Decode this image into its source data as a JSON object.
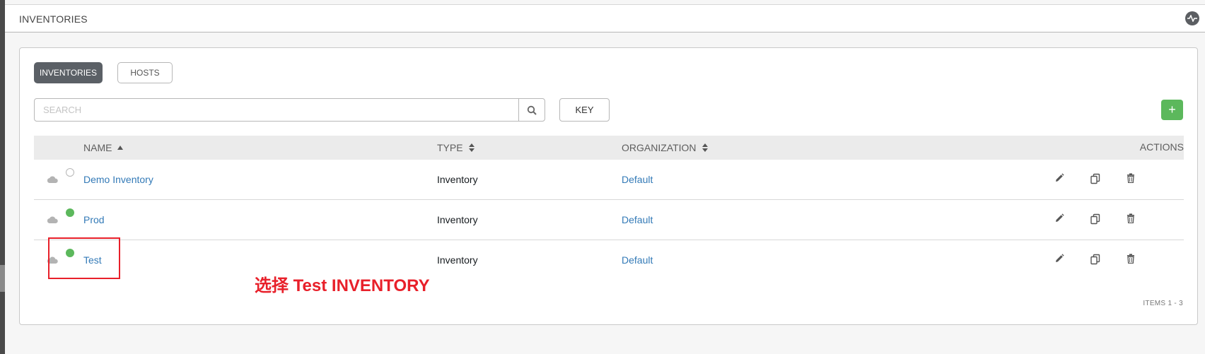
{
  "header": {
    "title": "INVENTORIES",
    "activity_icon": "activity-stream-icon"
  },
  "tabs": {
    "inventories": "INVENTORIES",
    "hosts": "HOSTS"
  },
  "search": {
    "placeholder": "SEARCH",
    "value": ""
  },
  "key_button": "KEY",
  "add_button": "+",
  "table": {
    "columns": {
      "name": "NAME",
      "type": "TYPE",
      "organization": "ORGANIZATION",
      "actions": "ACTIONS"
    },
    "rows": [
      {
        "name": "Demo Inventory",
        "type": "Inventory",
        "organization": "Default",
        "status": "none"
      },
      {
        "name": "Prod",
        "type": "Inventory",
        "organization": "Default",
        "status": "ok"
      },
      {
        "name": "Test",
        "type": "Inventory",
        "organization": "Default",
        "status": "ok"
      }
    ]
  },
  "annotation": "选择 Test INVENTORY",
  "pagination": "ITEMS  1 - 3",
  "colors": {
    "accent_green": "#5cb85c",
    "link_blue": "#337ab7",
    "annotation_red": "#e8202a",
    "tab_active": "#5b6066"
  }
}
